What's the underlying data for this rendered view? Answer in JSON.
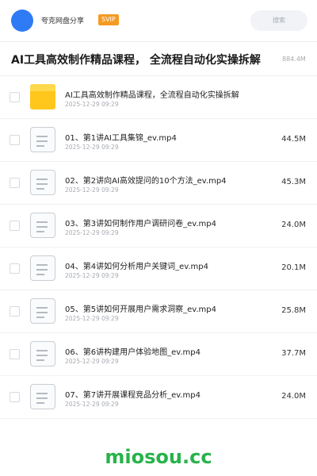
{
  "header": {
    "brand": "夸克网盘分享",
    "badge": "SVIP",
    "search_label": "搜索"
  },
  "title": {
    "text": "AI工具高效制作精品课程， 全流程自动化实操拆解",
    "size": "884.4M"
  },
  "items": [
    {
      "type": "folder",
      "name": "AI工具高效制作精品课程，全流程自动化实操拆解",
      "date": "2025-12-29 09:29",
      "size": ""
    },
    {
      "type": "file",
      "name": "01、第1讲AI工具集锦_ev.mp4",
      "date": "2025-12-29 09:29",
      "size": "44.5M"
    },
    {
      "type": "file",
      "name": "02、第2讲向AI高效提问的10个方法_ev.mp4",
      "date": "2025-12-29 09:29",
      "size": "45.3M"
    },
    {
      "type": "file",
      "name": "03、第3讲如何制作用户调研问卷_ev.mp4",
      "date": "2025-12-29 09:29",
      "size": "24.0M"
    },
    {
      "type": "file",
      "name": "04、第4讲如何分析用户关键词_ev.mp4",
      "date": "2025-12-29 09:29",
      "size": "20.1M"
    },
    {
      "type": "file",
      "name": "05、第5讲如何开展用户需求洞察_ev.mp4",
      "date": "2025-12-29 09:29",
      "size": "25.8M"
    },
    {
      "type": "file",
      "name": "06、第6讲构建用户体验地图_ev.mp4",
      "date": "2025-12-29 09:29",
      "size": "37.7M"
    },
    {
      "type": "file",
      "name": "07、第7讲开展课程竞品分析_ev.mp4",
      "date": "2025-12-29 09:29",
      "size": "24.0M"
    }
  ],
  "watermark": "miosou.cc"
}
